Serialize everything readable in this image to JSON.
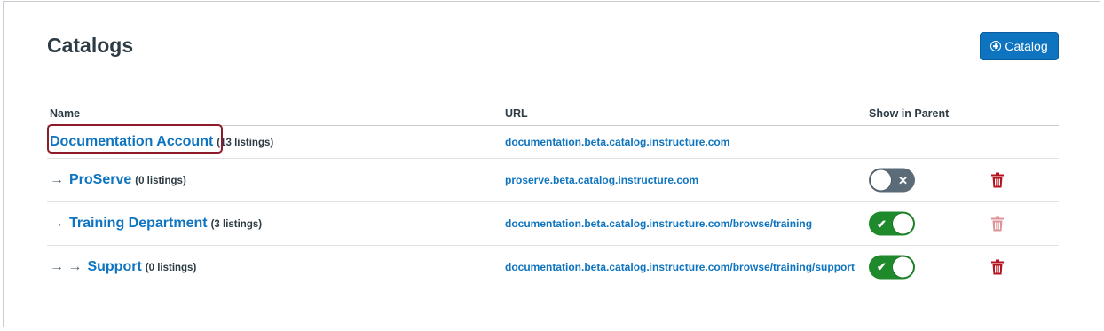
{
  "page": {
    "title": "Catalogs",
    "add_button_label": "Catalog"
  },
  "table": {
    "headers": {
      "name": "Name",
      "url": "URL",
      "show_in_parent": "Show in Parent"
    },
    "rows": [
      {
        "arrows": "",
        "name": "Documentation Account",
        "count": "(13 listings)",
        "url": "documentation.beta.catalog.instructure.com",
        "toggle": null,
        "delete_enabled": null
      },
      {
        "arrows": "→",
        "name": "ProServe",
        "count": "(0 listings)",
        "url": "proserve.beta.catalog.instructure.com",
        "toggle": "off",
        "delete_enabled": true
      },
      {
        "arrows": "→",
        "name": "Training Department",
        "count": "(3 listings)",
        "url": "documentation.beta.catalog.instructure.com/browse/training",
        "toggle": "on",
        "delete_enabled": false
      },
      {
        "arrows": "→ →",
        "name": "Support",
        "count": "(0 listings)",
        "url": "documentation.beta.catalog.instructure.com/browse/training/support",
        "toggle": "on",
        "delete_enabled": true
      }
    ]
  },
  "colors": {
    "link": "#0e74c0",
    "toggle_on": "#1f8a2b",
    "toggle_off": "#5b6b77",
    "delete": "#b5131e",
    "highlight": "#8e1b2a"
  },
  "icons": {
    "add": "plus-circle-icon",
    "toggle_on": "check-icon",
    "toggle_off": "x-icon",
    "delete": "trash-icon",
    "indent": "arrow-right-icon"
  }
}
